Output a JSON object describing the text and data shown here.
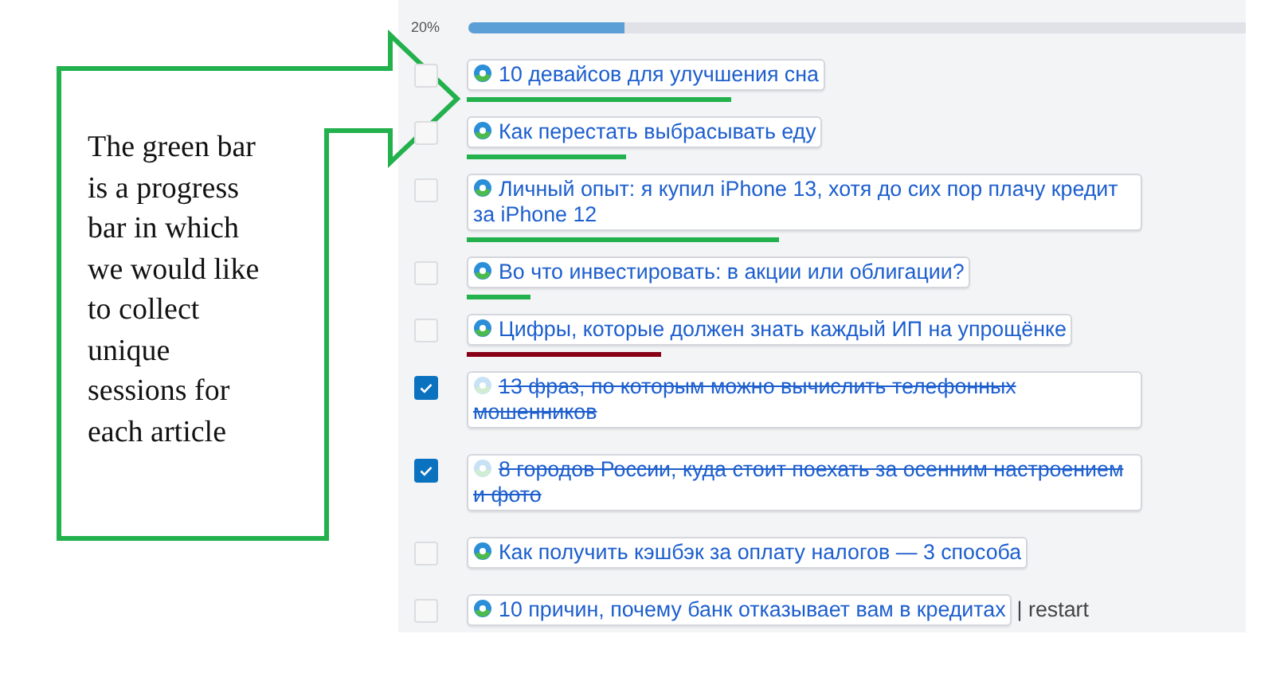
{
  "progress": {
    "label": "20%",
    "level": 0.2
  },
  "articles": [
    {
      "title": "10 девайсов для улучшения сна",
      "checked": false,
      "bar": {
        "color": "#22b14c"
      }
    },
    {
      "title": "Как перестать выбрасывать еду",
      "checked": false,
      "bar": {
        "color": "#22b14c"
      }
    },
    {
      "title": "Личный опыт: я купил iPhone 13, хотя до сих пор плачу кредит за iPhone 12",
      "checked": false,
      "bar": {
        "color": "#22b14c"
      }
    },
    {
      "title": "Во что инвестировать: в акции или облигации?",
      "checked": false,
      "bar": {
        "color": "#22b14c"
      }
    },
    {
      "title": "Цифры, которые должен знать каждый ИП на упрощёнке",
      "checked": false,
      "bar": {
        "color": "#880015"
      }
    },
    {
      "title": "13 фраз, по которым можно вычислить телефонных мошенников",
      "checked": true
    },
    {
      "title": "8 городов России, куда стоит поехать за осенним настроением и фото",
      "checked": true
    },
    {
      "title": "Как получить кэшбэк за оплату налогов — 3 способа",
      "checked": false
    },
    {
      "title": "10 причин, почему банк отказывает вам в кредитах",
      "checked": false,
      "trailing_text": "| restart"
    }
  ],
  "callout": {
    "text": "The green bar is a progress bar in which we would like to collect unique sessions for each article"
  }
}
